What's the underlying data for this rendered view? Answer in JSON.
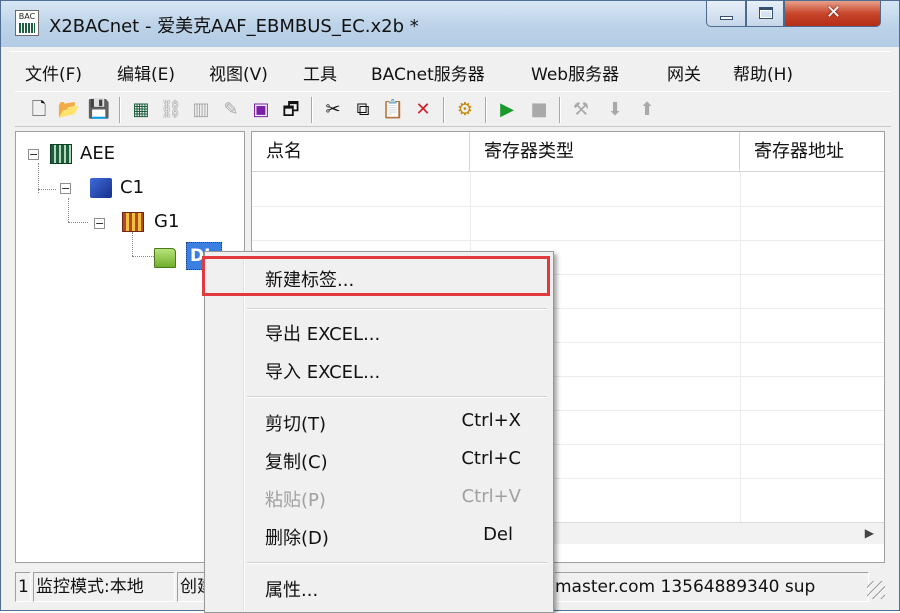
{
  "window": {
    "icon_text": "BAC",
    "title": "X2BACnet - 爱美克AAF_EBMBUS_EC.x2b *",
    "accent": "#b3cbe4",
    "close_color": "#c7452b"
  },
  "menu": [
    "文件(F)",
    "编辑(E)",
    "视图(V)",
    "工具",
    "BACnet服务器",
    "Web服务器",
    "网关",
    "帮助(H)"
  ],
  "toolbar_icons": [
    "new-file-icon",
    "open-folder-icon",
    "save-icon",
    "device-grid-icon",
    "connect-icon",
    "group-icon",
    "tag-icon",
    "di-icon",
    "properties-icon",
    "cut-icon",
    "copy-icon",
    "paste-icon",
    "delete-icon",
    "debug-icon",
    "run-icon",
    "stop-icon",
    "tools-icon",
    "load-icon",
    "upload-icon"
  ],
  "tree": {
    "root": "AEE",
    "channel": "C1",
    "group": "G1",
    "tag": "DI"
  },
  "list": {
    "columns": [
      "点名",
      "寄存器类型",
      "寄存器地址"
    ]
  },
  "status": {
    "left": "1",
    "mode": "监控模式:本地",
    "create": "创建",
    "contact": "master.com 13564889340 sup"
  },
  "context_menu": {
    "items": [
      {
        "label": "新建标签...",
        "shortcut": "",
        "enabled": true
      },
      {
        "label": "导出 EXCEL...",
        "shortcut": "",
        "enabled": true
      },
      {
        "label": "导入 EXCEL...",
        "shortcut": "",
        "enabled": true
      },
      {
        "label": "剪切(T)",
        "shortcut": "Ctrl+X",
        "enabled": true
      },
      {
        "label": "复制(C)",
        "shortcut": "Ctrl+C",
        "enabled": true
      },
      {
        "label": "粘贴(P)",
        "shortcut": "Ctrl+V",
        "enabled": false
      },
      {
        "label": "删除(D)",
        "shortcut": "Del",
        "enabled": true
      },
      {
        "label": "属性...",
        "shortcut": "",
        "enabled": true
      }
    ],
    "highlight_color": "#e0393e"
  }
}
